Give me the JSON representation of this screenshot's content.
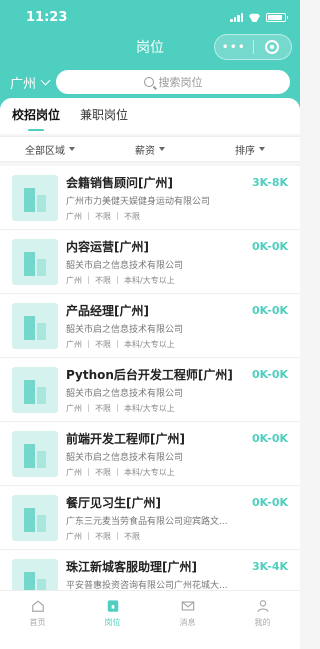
{
  "status": {
    "time": "11:23"
  },
  "nav": {
    "title": "岗位",
    "more": "•••"
  },
  "search": {
    "city": "广州",
    "placeholder": "搜索岗位"
  },
  "tabs": [
    {
      "label": "校招岗位"
    },
    {
      "label": "兼职岗位"
    }
  ],
  "filters": [
    {
      "label": "全部区域"
    },
    {
      "label": "薪资"
    },
    {
      "label": "排序"
    }
  ],
  "jobs": [
    {
      "title": "会籍销售顾问[广州]",
      "salary": "3K-8K",
      "company": "广州市力美健天娱健身运动有限公司",
      "tags": [
        "广州",
        "不限",
        "不限"
      ]
    },
    {
      "title": "内容运营[广州]",
      "salary": "0K-0K",
      "company": "韶关市启之信息技术有限公司",
      "tags": [
        "广州",
        "不限",
        "本科/大专以上"
      ]
    },
    {
      "title": "产品经理[广州]",
      "salary": "0K-0K",
      "company": "韶关市启之信息技术有限公司",
      "tags": [
        "广州",
        "不限",
        "本科/大专以上"
      ]
    },
    {
      "title": "Python后台开发工程师[广州]",
      "salary": "0K-0K",
      "company": "韶关市启之信息技术有限公司",
      "tags": [
        "广州",
        "不限",
        "本科/大专以上"
      ]
    },
    {
      "title": "前端开发工程师[广州]",
      "salary": "0K-0K",
      "company": "韶关市启之信息技术有限公司",
      "tags": [
        "广州",
        "不限",
        "本科/大专以上"
      ]
    },
    {
      "title": "餐厅见习生[广州]",
      "salary": "0K-0K",
      "company": "广东三元麦当劳食品有限公司迎宾路文...",
      "tags": [
        "广州",
        "不限",
        "不限"
      ]
    },
    {
      "title": "珠江新城客服助理[广州]",
      "salary": "3K-4K",
      "company": "平安普惠投资咨询有限公司广州花城大...",
      "tags": [
        "广州",
        "不限",
        "不限"
      ]
    }
  ],
  "tabbar": [
    {
      "label": "首页",
      "icon": "home-icon"
    },
    {
      "label": "岗位",
      "icon": "briefcase-icon"
    },
    {
      "label": "消息",
      "icon": "mail-icon"
    },
    {
      "label": "我的",
      "icon": "person-icon"
    }
  ],
  "colors": {
    "accent": "#4fcfc0"
  }
}
